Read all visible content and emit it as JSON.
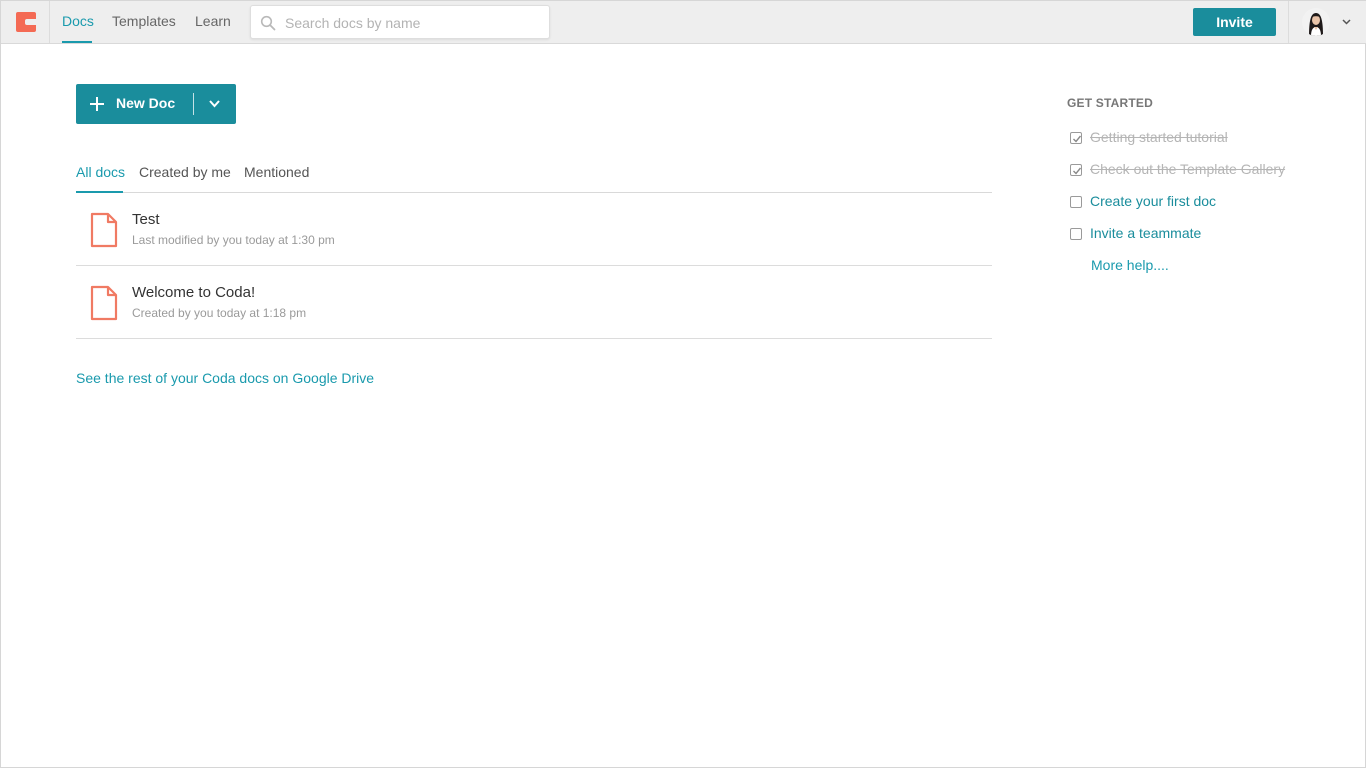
{
  "nav": {
    "tabs": [
      {
        "label": "Docs"
      },
      {
        "label": "Templates"
      },
      {
        "label": "Learn"
      }
    ],
    "search_placeholder": "Search docs by name",
    "invite_label": "Invite"
  },
  "new_doc": {
    "label": "New Doc"
  },
  "doc_tabs": [
    {
      "label": "All docs"
    },
    {
      "label": "Created by me"
    },
    {
      "label": "Mentioned"
    }
  ],
  "docs": [
    {
      "title": "Test",
      "meta": "Last modified by you today at 1:30 pm"
    },
    {
      "title": "Welcome to Coda!",
      "meta": "Created by you today at 1:18 pm"
    }
  ],
  "drive_link": "See the rest of your Coda docs on Google Drive",
  "get_started": {
    "heading": "GET STARTED",
    "items": [
      {
        "label": "Getting started tutorial",
        "done": true
      },
      {
        "label": "Check out the Template Gallery",
        "done": true
      },
      {
        "label": "Create your first doc",
        "done": false
      },
      {
        "label": "Invite a teammate",
        "done": false
      }
    ],
    "more_help": "More help...."
  },
  "colors": {
    "accent": "#1a9aad",
    "button": "#1a8d9c",
    "logo": "#f46a54"
  },
  "icons": {
    "logo": "coda-logo-icon",
    "search": "search-icon",
    "doc": "document-icon",
    "plus": "plus-icon",
    "caret": "chevron-down-icon",
    "check": "check-icon"
  }
}
